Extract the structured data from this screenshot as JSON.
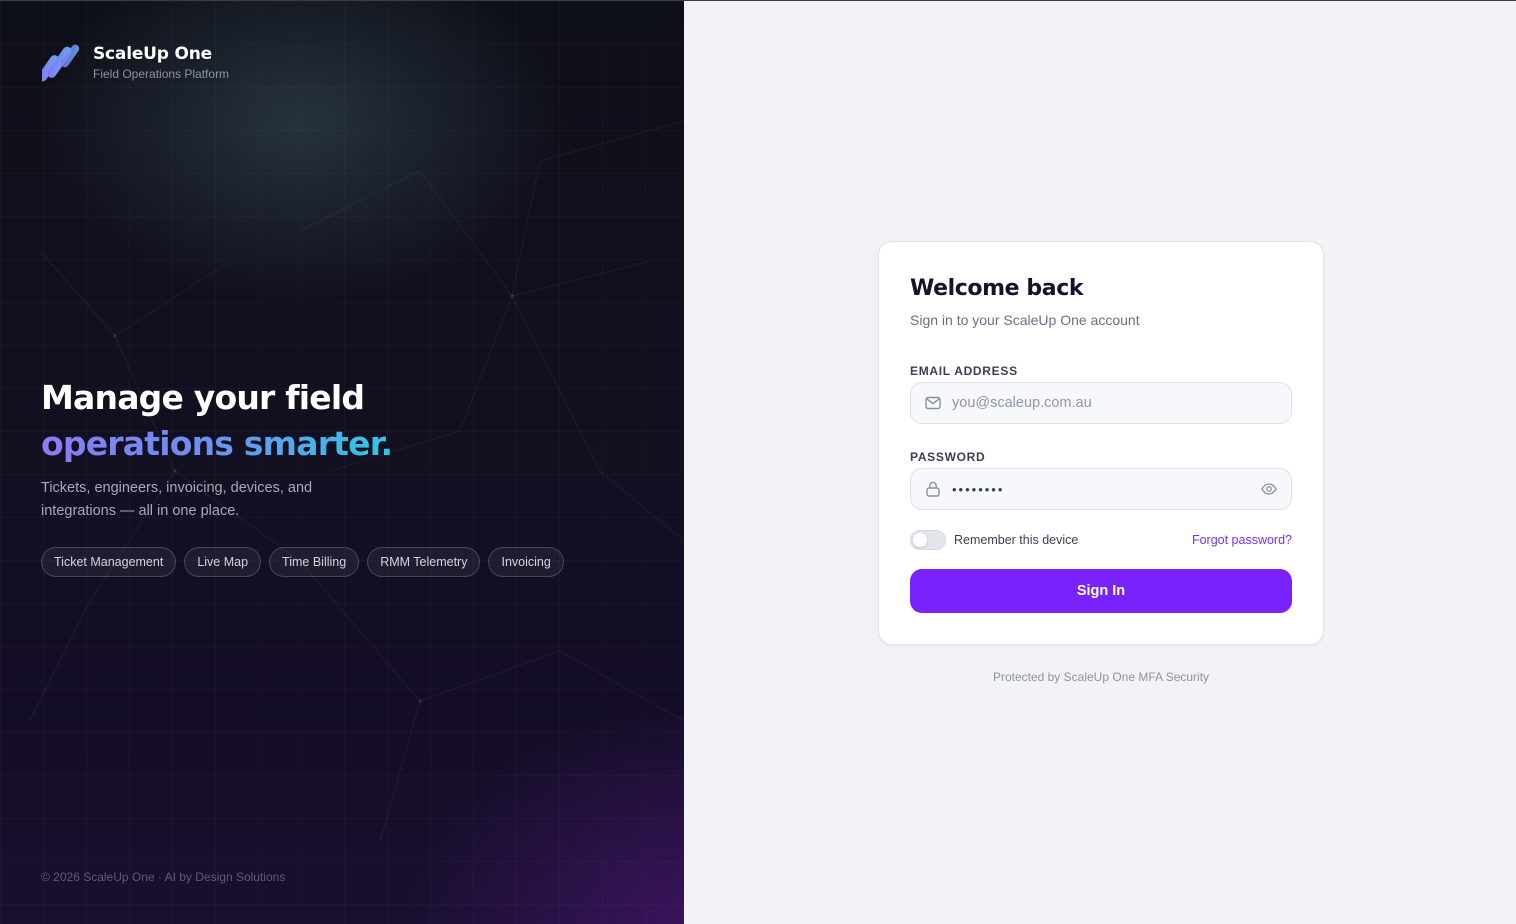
{
  "brand": {
    "name": "ScaleUp One",
    "subtitle": "Field Operations Platform"
  },
  "hero": {
    "headline_line1": "Manage your field",
    "headline_line2": "operations smarter.",
    "tagline": "Tickets, engineers, invoicing, devices, and integrations — all in one place.",
    "chips": [
      "Ticket Management",
      "Live Map",
      "Time Billing",
      "RMM Telemetry",
      "Invoicing"
    ],
    "footer": "© 2026 ScaleUp One · AI by Design Solutions"
  },
  "login": {
    "title": "Welcome back",
    "subtitle": "Sign in to your ScaleUp One account",
    "email_label": "EMAIL ADDRESS",
    "email_placeholder": "you@scaleup.com.au",
    "email_value": "",
    "password_label": "PASSWORD",
    "password_masked": "••••••••",
    "remember_label": "Remember this device",
    "remember_checked": false,
    "forgot_label": "Forgot password?",
    "signin_label": "Sign In",
    "protected_note": "Protected by ScaleUp One MFA Security"
  },
  "colors": {
    "accent": "#7a22fb",
    "link": "#7a2ff0",
    "hero_bg": "#121020",
    "gradient_start": "#8b7bf2",
    "gradient_end": "#2ec9e6"
  },
  "icons": {
    "logo": "scaleup-logo-icon",
    "email": "mail-icon",
    "password": "lock-icon",
    "reveal": "eye-icon"
  }
}
